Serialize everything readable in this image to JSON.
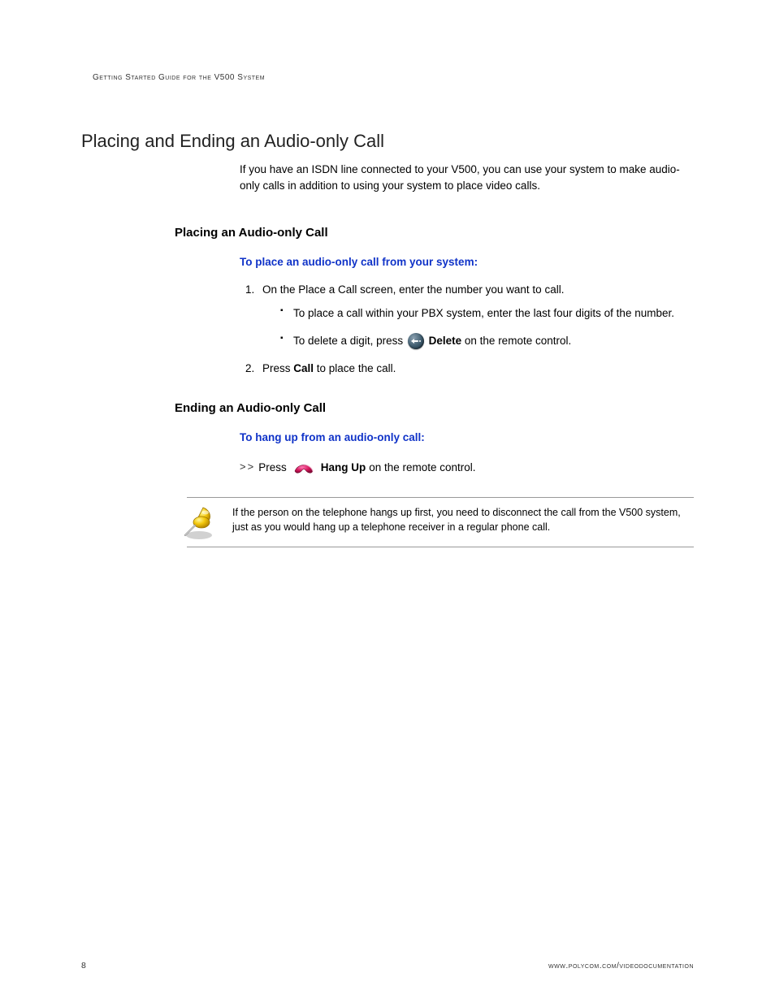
{
  "header": "Getting Started Guide for the V500 System",
  "h1": "Placing and Ending an Audio-only Call",
  "intro": "If you have an ISDN line connected to your V500, you can use your system to make audio-only calls in addition to using your system to place video calls.",
  "section1": {
    "title": "Placing an Audio-only Call",
    "proc": "To place an audio-only call from your system:",
    "step1": "On the Place a Call screen, enter the number you want to call.",
    "bullet1": "To place a call within your PBX system, enter the last four digits of the number.",
    "bullet2a": "To delete a digit, press ",
    "bullet2_bold": "Delete",
    "bullet2b": " on the remote control.",
    "step2a": "Press ",
    "step2_bold": "Call",
    "step2b": " to place the call."
  },
  "section2": {
    "title": "Ending an Audio-only Call",
    "proc": "To hang up from an audio-only call:",
    "arrows": ">>",
    "press": "Press ",
    "hangup_bold": "Hang Up",
    "press_after": " on the remote control."
  },
  "note": "If the person on the telephone hangs up first, you need to disconnect the call from the V500 system, just as you would hang up a telephone receiver in a regular phone call.",
  "footer": {
    "page_num": "8",
    "url": "www.polycom.com/videodocumentation"
  }
}
